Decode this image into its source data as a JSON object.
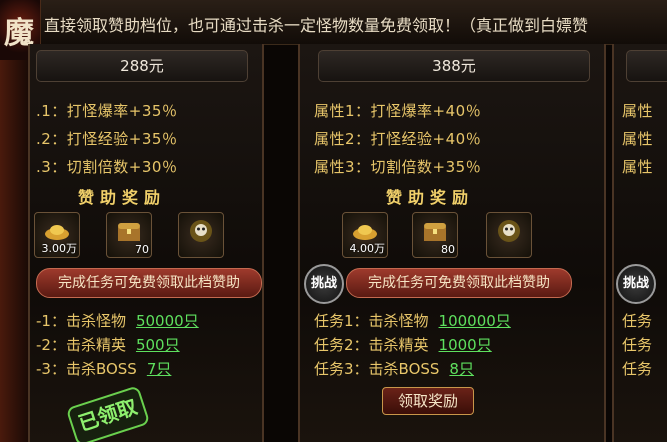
{
  "banner": {
    "text": "直接领取赞助档位，也可通过击杀一定怪物数量免费领取！（真正做到白嫖赞"
  },
  "logo": {
    "glyph": "魔"
  },
  "reward_title": "赞助奖励",
  "task_banner_text": "完成任务可免费领取此档赞助",
  "challenge_label": "挑战",
  "claim_label": "领取奖励",
  "claimed_label": "已领取",
  "panels": [
    {
      "price": "288元",
      "attrs": [
        ".1：打怪爆率+35％",
        ".2：打怪经验+35％",
        ".3：切割倍数+30％"
      ],
      "items": [
        "3.00万",
        "70",
        ""
      ],
      "tasks": [
        {
          "label": "-1：击杀怪物",
          "num": "50000只"
        },
        {
          "label": "-2：击杀精英",
          "num": "500只"
        },
        {
          "label": "-3：击杀BOSS",
          "num": "7只"
        }
      ]
    },
    {
      "price": "388元",
      "attrs": [
        "属性1：打怪爆率+40％",
        "属性2：打怪经验+40％",
        "属性3：切割倍数+35％"
      ],
      "items": [
        "4.00万",
        "80",
        ""
      ],
      "tasks": [
        {
          "label": "任务1：击杀怪物",
          "num": "100000只"
        },
        {
          "label": "任务2：击杀精英",
          "num": "1000只"
        },
        {
          "label": "任务3：击杀BOSS",
          "num": "8只"
        }
      ]
    },
    {
      "attrs": [
        "属性",
        "属性",
        "属性"
      ],
      "tasks": [
        {
          "label": "任务"
        },
        {
          "label": "任务"
        },
        {
          "label": "任务"
        }
      ]
    }
  ]
}
